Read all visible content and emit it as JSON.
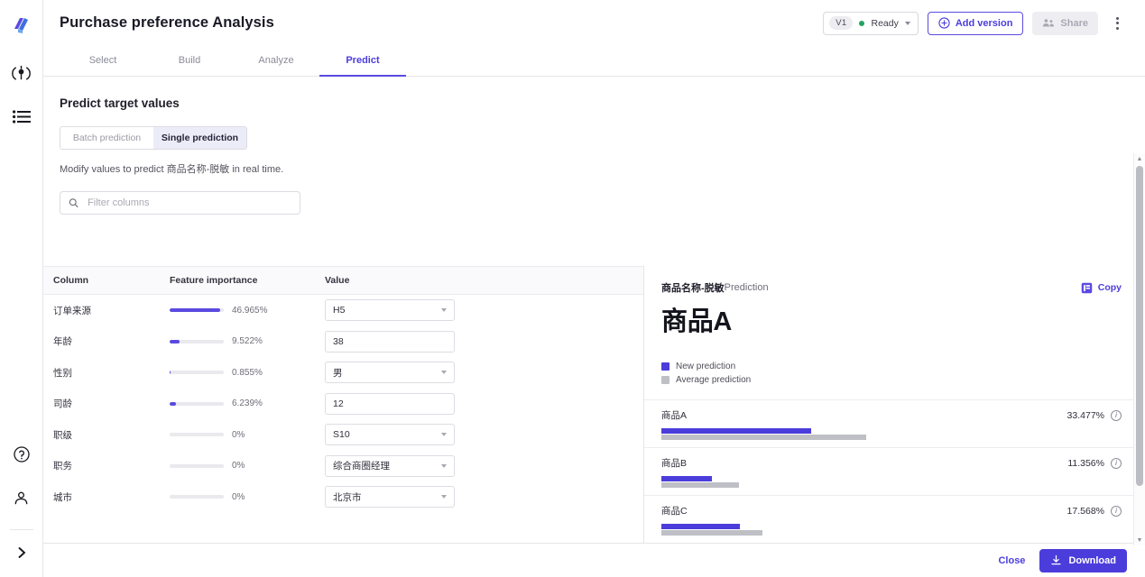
{
  "rail": {
    "logo": "app-logo",
    "items": [
      {
        "name": "model-icon",
        "label": "Models"
      },
      {
        "name": "list-icon",
        "label": "Projects"
      }
    ],
    "bottom": [
      {
        "name": "help-icon",
        "label": "Help"
      },
      {
        "name": "account-icon",
        "label": "Account"
      },
      {
        "name": "expand-icon",
        "label": "Expand"
      }
    ]
  },
  "header": {
    "title": "Purchase preference Analysis",
    "version_chip": "V1",
    "status": "Ready",
    "add_version": "Add version",
    "share": "Share",
    "menu": "more-options"
  },
  "tabs": [
    {
      "label": "Select",
      "active": false
    },
    {
      "label": "Build",
      "active": false
    },
    {
      "label": "Analyze",
      "active": false
    },
    {
      "label": "Predict",
      "active": true
    }
  ],
  "predict": {
    "section_title": "Predict target values",
    "modes": [
      {
        "label": "Batch prediction",
        "active": false
      },
      {
        "label": "Single prediction",
        "active": true
      }
    ],
    "hint": "Modify values to predict 商品名称-脱敏 in real time.",
    "search_placeholder": "Filter columns",
    "search_value": ""
  },
  "table": {
    "headers": [
      "Column",
      "Feature importance",
      "Value"
    ],
    "rows": [
      {
        "column": "订单来源",
        "importance_pct": "46.965%",
        "importance": 46.965,
        "value": "H5",
        "control": "select"
      },
      {
        "column": "年龄",
        "importance_pct": "9.522%",
        "importance": 9.522,
        "value": "38",
        "control": "input"
      },
      {
        "column": "性别",
        "importance_pct": "0.855%",
        "importance": 0.855,
        "value": "男",
        "control": "select"
      },
      {
        "column": "司龄",
        "importance_pct": "6.239%",
        "importance": 6.239,
        "value": "12",
        "control": "input"
      },
      {
        "column": "职级",
        "importance_pct": "0%",
        "importance": 0,
        "value": "S10",
        "control": "select"
      },
      {
        "column": "职务",
        "importance_pct": "0%",
        "importance": 0,
        "value": "综合商圈经理",
        "control": "select"
      },
      {
        "column": "城市",
        "importance_pct": "0%",
        "importance": 0,
        "value": "北京市",
        "control": "select"
      }
    ]
  },
  "prediction": {
    "target_name": "商品名称-脱敏",
    "label_suffix": " Prediction",
    "copy_label": "Copy",
    "result": "商品A",
    "legend": [
      {
        "label": "New prediction",
        "color": "#4b3ddb"
      },
      {
        "label": "Average prediction",
        "color": "#bfbfc6"
      }
    ],
    "rows": [
      {
        "label": "商品A",
        "pct": "33.477%",
        "new": 33.477,
        "avg": 45.8
      },
      {
        "label": "商品B",
        "pct": "11.356%",
        "new": 11.356,
        "avg": 17.3
      },
      {
        "label": "商品C",
        "pct": "17.568%",
        "new": 17.568,
        "avg": 22.6
      }
    ]
  },
  "footer": {
    "close": "Close",
    "download": "Download"
  },
  "colors": {
    "accent": "#4b3ddb",
    "accent_light": "#ececf8",
    "avg_bar": "#bfbfc6",
    "status_green": "#1fa463"
  }
}
